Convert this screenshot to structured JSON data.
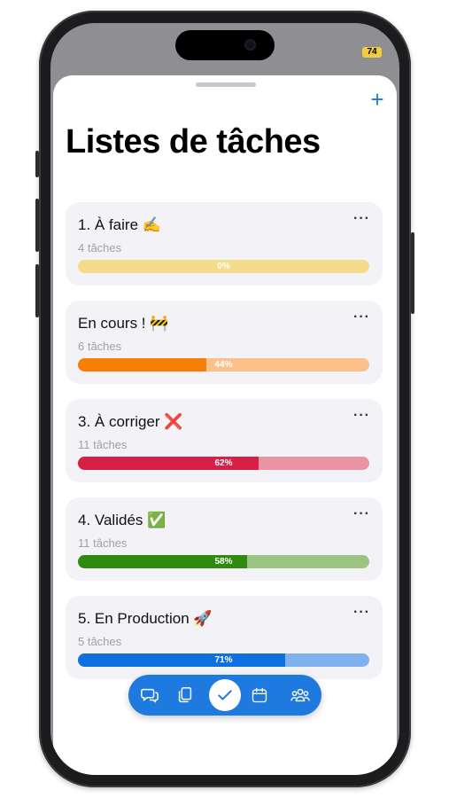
{
  "status": {
    "battery": "74"
  },
  "header": {
    "title": "Listes de tâches",
    "add_label": "+"
  },
  "lists": [
    {
      "title": "1. À faire ✍️",
      "count": "4 tâches",
      "progress": 0,
      "progress_label": "0%",
      "color": "#f1d27e",
      "track": "#f3dc8c",
      "more": "···"
    },
    {
      "title": "En cours ! 🚧",
      "count": "6 tâches",
      "progress": 44,
      "progress_label": "44%",
      "color": "#f77f08",
      "track": "#fcc08a",
      "more": "···"
    },
    {
      "title": "3. À corriger ❌",
      "count": "11 tâches",
      "progress": 62,
      "progress_label": "62%",
      "color": "#d81f45",
      "track": "#ea93a2",
      "more": "···"
    },
    {
      "title": "4. Validés ✅",
      "count": "11 tâches",
      "progress": 58,
      "progress_label": "58%",
      "color": "#2f8a10",
      "track": "#9bc482",
      "more": "···"
    },
    {
      "title": "5. En Production 🚀",
      "count": "5 tâches",
      "progress": 71,
      "progress_label": "71%",
      "color": "#0e6fe0",
      "track": "#7fb1ee",
      "more": "···"
    }
  ],
  "tabbar": {
    "items": [
      {
        "icon": "chat-bubbles-icon",
        "active": false
      },
      {
        "icon": "documents-icon",
        "active": false
      },
      {
        "icon": "checkmark-icon",
        "active": true
      },
      {
        "icon": "calendar-icon",
        "active": false
      },
      {
        "icon": "people-icon",
        "active": false
      }
    ]
  }
}
